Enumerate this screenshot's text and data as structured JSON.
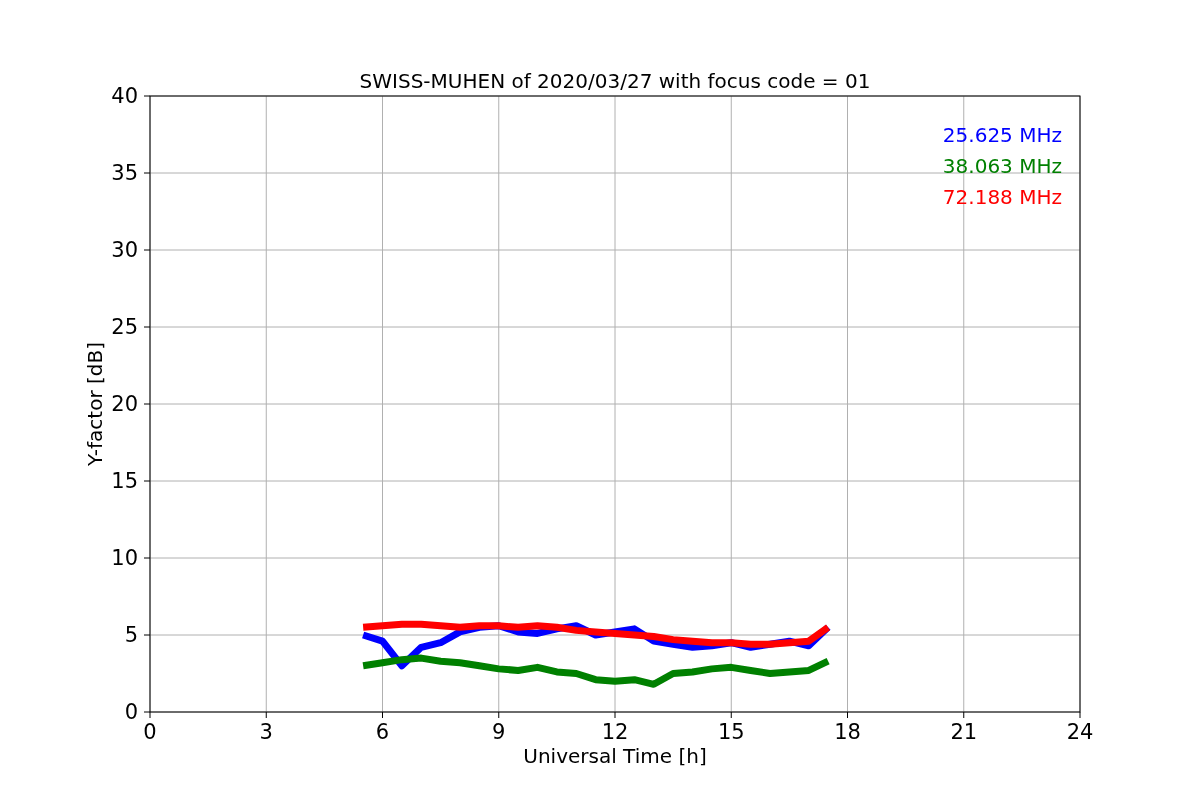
{
  "figure": {
    "chart_data": {
      "type": "line",
      "title": "SWISS-MUHEN of 2020/03/27 with focus code = 01",
      "xlabel": "Universal Time [h]",
      "ylabel": "Y-factor [dB]",
      "xlim": [
        0,
        24
      ],
      "ylim": [
        0,
        40
      ],
      "xticks": [
        0,
        3,
        6,
        9,
        12,
        15,
        18,
        21,
        24
      ],
      "yticks": [
        0,
        5,
        10,
        15,
        20,
        25,
        30,
        35,
        40
      ],
      "grid": true,
      "x": [
        5.5,
        6,
        6.5,
        7,
        7.5,
        8,
        8.5,
        9,
        9.5,
        10,
        10.5,
        11,
        11.5,
        12,
        12.5,
        13,
        13.5,
        14,
        14.5,
        15,
        15.5,
        16,
        16.5,
        17,
        17.5
      ],
      "series": [
        {
          "name": "25.625 MHz",
          "color": "#0000ff",
          "values": [
            5.0,
            4.6,
            3.0,
            4.2,
            4.5,
            5.2,
            5.5,
            5.6,
            5.2,
            5.1,
            5.4,
            5.6,
            5.0,
            5.2,
            5.4,
            4.6,
            4.4,
            4.2,
            4.3,
            4.5,
            4.2,
            4.4,
            4.6,
            4.3,
            5.5
          ]
        },
        {
          "name": "38.063 MHz",
          "color": "#008000",
          "values": [
            3.0,
            3.2,
            3.4,
            3.5,
            3.3,
            3.2,
            3.0,
            2.8,
            2.7,
            2.9,
            2.6,
            2.5,
            2.1,
            2.0,
            2.1,
            1.8,
            2.5,
            2.6,
            2.8,
            2.9,
            2.7,
            2.5,
            2.6,
            2.7,
            3.3
          ]
        },
        {
          "name": "72.188 MHz",
          "color": "#ff0000",
          "values": [
            5.5,
            5.6,
            5.7,
            5.7,
            5.6,
            5.5,
            5.6,
            5.6,
            5.5,
            5.6,
            5.5,
            5.3,
            5.2,
            5.1,
            5.0,
            4.9,
            4.7,
            4.6,
            4.5,
            4.5,
            4.4,
            4.4,
            4.5,
            4.6,
            5.5
          ]
        }
      ]
    }
  }
}
